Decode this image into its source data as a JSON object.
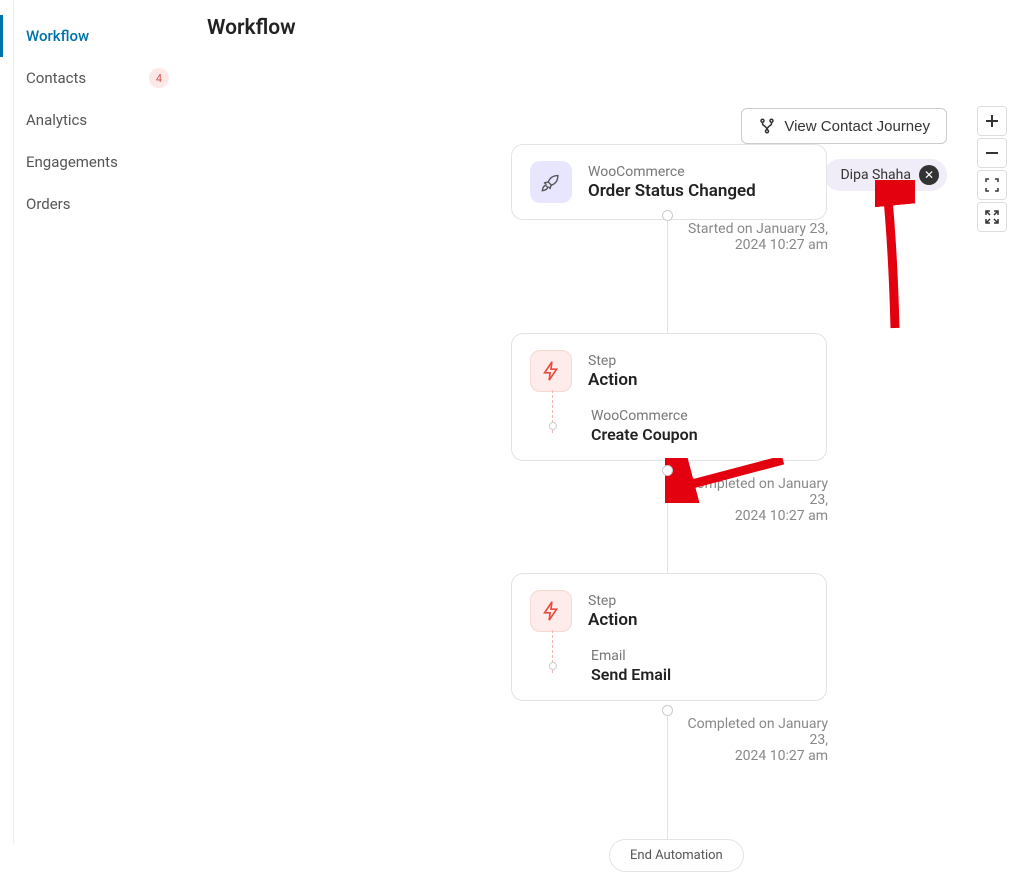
{
  "sidebar": {
    "items": [
      {
        "label": "Workflow",
        "active": true
      },
      {
        "label": "Contacts",
        "badge": "4"
      },
      {
        "label": "Analytics"
      },
      {
        "label": "Engagements"
      },
      {
        "label": "Orders"
      }
    ]
  },
  "header": {
    "title": "Workflow",
    "view_journey_button": "View Contact Journey",
    "contact_chip": "Dipa Shaha"
  },
  "nodes": {
    "trigger": {
      "category": "WooCommerce",
      "title": "Order Status Changed",
      "timestamp_line1": "Started on January 23,",
      "timestamp_line2": "2024 10:27 am"
    },
    "action1": {
      "step_label": "Step",
      "step_title": "Action",
      "sub_category": "WooCommerce",
      "sub_title": "Create Coupon",
      "timestamp_line1": "Completed on January 23,",
      "timestamp_line2": "2024 10:27 am"
    },
    "action2": {
      "step_label": "Step",
      "step_title": "Action",
      "sub_category": "Email",
      "sub_title": "Send Email",
      "timestamp_line1": "Completed on January 23,",
      "timestamp_line2": "2024 10:27 am"
    }
  },
  "end_button": "End Automation"
}
